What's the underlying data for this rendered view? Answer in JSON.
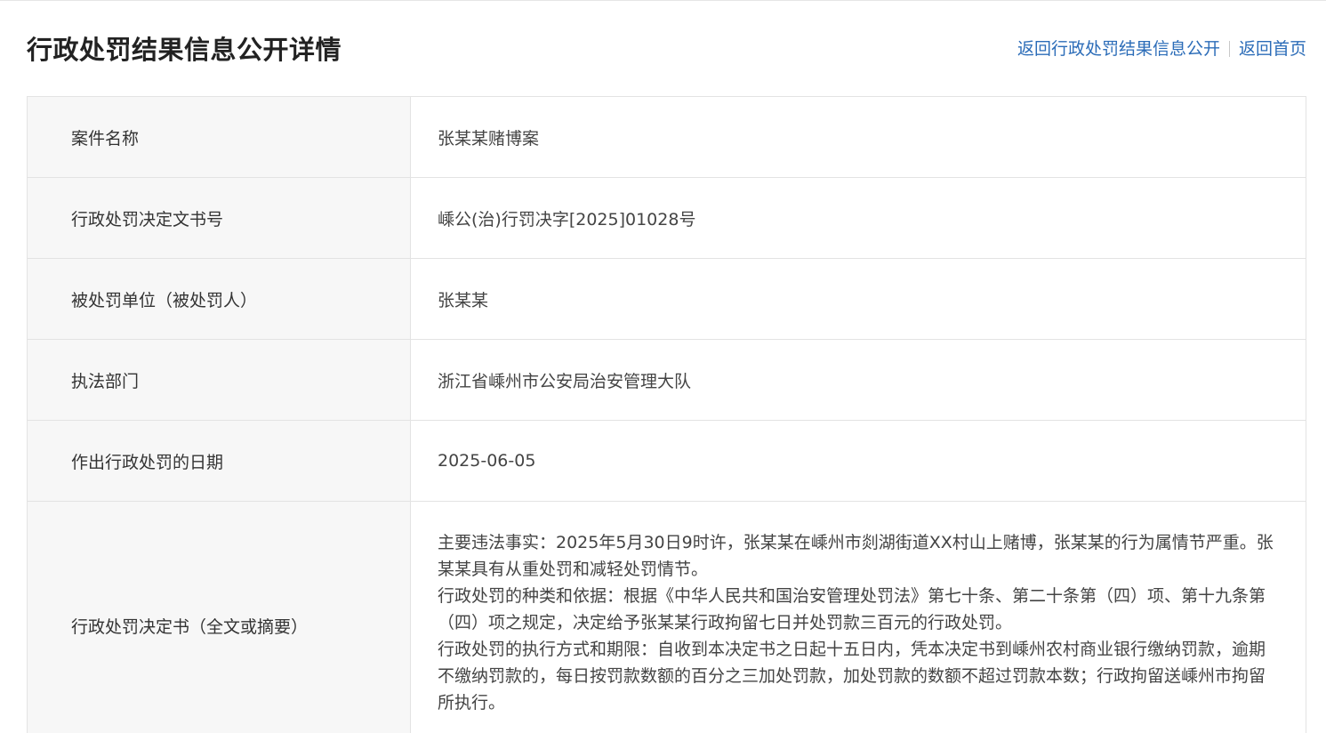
{
  "header": {
    "title": "行政处罚结果信息公开详情",
    "link_back_list": "返回行政处罚结果信息公开",
    "link_home": "返回首页"
  },
  "rows": [
    {
      "label": "案件名称",
      "value": "张某某赌博案"
    },
    {
      "label": "行政处罚决定文书号",
      "value": "嵊公(治)行罚决字[2025]01028号"
    },
    {
      "label": "被处罚单位（被处罚人）",
      "value": "张某某"
    },
    {
      "label": "执法部门",
      "value": "浙江省嵊州市公安局治安管理大队"
    },
    {
      "label": "作出行政处罚的日期",
      "value": "2025-06-05"
    },
    {
      "label": "行政处罚决定书（全文或摘要）",
      "paragraphs": [
        "主要违法事实：2025年5月30日9时许，张某某在嵊州市剡湖街道XX村山上赌博，张某某的行为属情节严重。张某某具有从重处罚和减轻处罚情节。",
        "行政处罚的种类和依据：根据《中华人民共和国治安管理处罚法》第七十条、第二十条第（四）项、第十九条第（四）项之规定，决定给予张某某行政拘留七日并处罚款三百元的行政处罚。",
        "行政处罚的执行方式和期限：自收到本决定书之日起十五日内，凭本决定书到嵊州农村商业银行缴纳罚款，逾期不缴纳罚款的，每日按罚款数额的百分之三加处罚款，加处罚款的数额不超过罚款本数；行政拘留送嵊州市拘留所执行。"
      ]
    }
  ]
}
